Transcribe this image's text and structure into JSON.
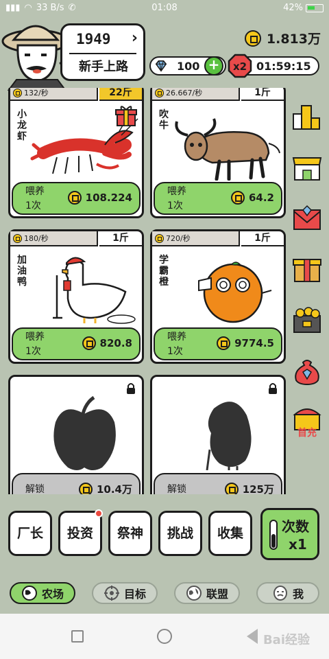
{
  "status_bar": {
    "signal": "33 B/s",
    "time": "01:08",
    "battery": "42%"
  },
  "header": {
    "level": "1949",
    "title": "新手上路",
    "coins": "1.813万",
    "gems": "100",
    "multiplier": "x2",
    "timer": "01:59:15"
  },
  "animals": [
    {
      "name": "小龙虾",
      "rate": "132/秒",
      "weight": "22斤",
      "action": "喂养",
      "times": "1次",
      "cost": "108.224",
      "locked": false
    },
    {
      "name": "吹牛",
      "rate": "26.667/秒",
      "weight": "1斤",
      "action": "喂养",
      "times": "1次",
      "cost": "64.2",
      "locked": false
    },
    {
      "name": "加油鸭",
      "rate": "180/秒",
      "weight": "1斤",
      "action": "喂养",
      "times": "1次",
      "cost": "820.8",
      "locked": false
    },
    {
      "name": "学霸橙",
      "rate": "720/秒",
      "weight": "1斤",
      "action": "喂养",
      "times": "1次",
      "cost": "9774.5",
      "locked": false
    },
    {
      "action": "解锁",
      "cost": "10.4万",
      "locked": true
    },
    {
      "action": "解锁",
      "cost": "125万",
      "locked": true
    }
  ],
  "side_icons": [
    "ranking-icon",
    "shop-icon",
    "mail-icon",
    "gift-box-icon",
    "treasure-chest-icon",
    "money-bag-icon",
    "first-recharge-icon"
  ],
  "side_labels": {
    "first_recharge": "首充"
  },
  "actions": {
    "factory": "厂长",
    "invest": "投资",
    "worship": "祭神",
    "challenge": "挑战",
    "collect": "收集",
    "times_line1": "次数",
    "times_line2": "x1"
  },
  "nav": {
    "farm": "农场",
    "goal": "目标",
    "alliance": "联盟",
    "me": "我"
  },
  "watermark": "Bai经验",
  "colors": {
    "background": "#b9c3b2",
    "feed_green": "#8fd46b",
    "gold": "#f2c72a",
    "ink": "#1c1c1c"
  }
}
